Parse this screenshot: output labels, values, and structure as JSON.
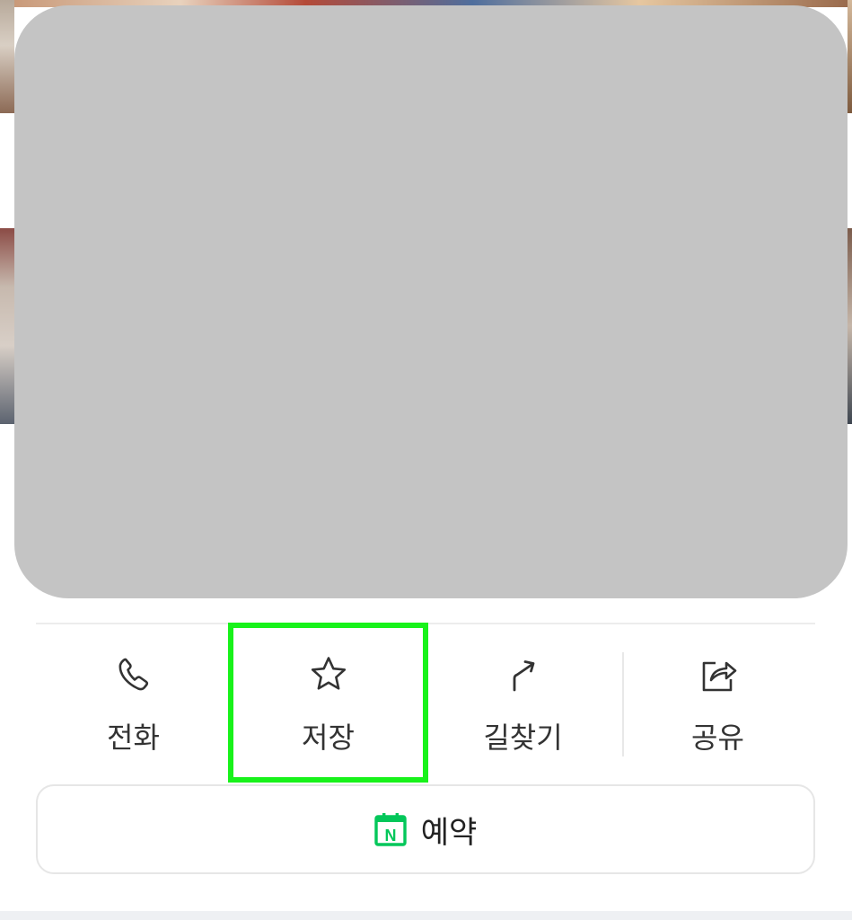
{
  "actions": [
    {
      "label": "전화",
      "icon": "phone-icon"
    },
    {
      "label": "저장",
      "icon": "star-icon"
    },
    {
      "label": "길찾기",
      "icon": "directions-icon"
    },
    {
      "label": "공유",
      "icon": "share-icon"
    }
  ],
  "reserve": {
    "label": "예약",
    "icon": "naver-calendar-icon",
    "icon_letter": "N",
    "icon_color": "#03c75a"
  },
  "colors": {
    "highlight": "#18f21a",
    "overlay": "#c4c4c4",
    "text": "#333333"
  }
}
